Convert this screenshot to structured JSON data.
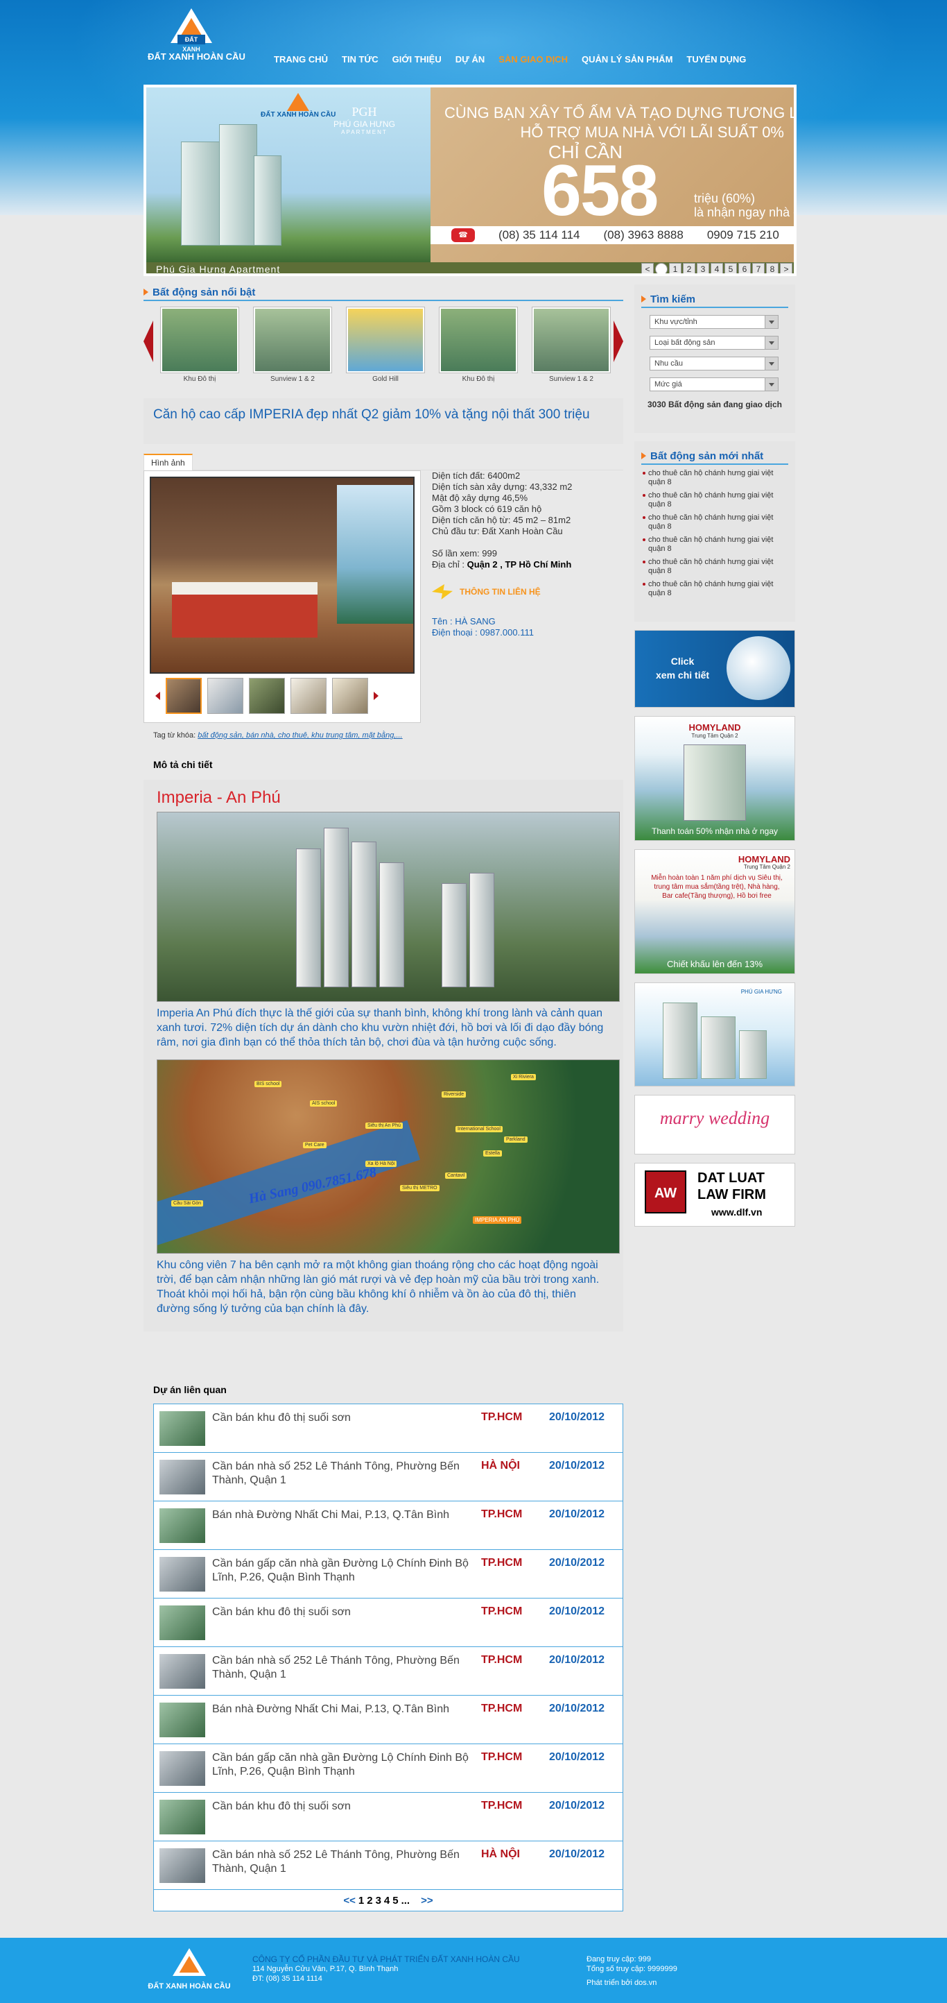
{
  "brand": {
    "logo_mark": "ĐẤT XANH",
    "name": "ĐẤT XANH HOÀN CẦU"
  },
  "nav": [
    {
      "label": "TRANG CHỦ",
      "active": false
    },
    {
      "label": "TIN TỨC",
      "active": false
    },
    {
      "label": "GIỚI THIỆU",
      "active": false
    },
    {
      "label": "DỰ ÁN",
      "active": false
    },
    {
      "label": "SÀN GIAO DỊCH",
      "active": true
    },
    {
      "label": "QUẢN LÝ SẢN PHẨM",
      "active": false
    },
    {
      "label": "TUYỂN DỤNG",
      "active": false
    }
  ],
  "banner": {
    "logo_text": "ĐẤT XANH HOÀN CẦU",
    "pgh": "PHÚ GIA HƯNG",
    "pgh_sub": "APARTMENT",
    "line1": "CÙNG BẠN XÂY TỔ ẤM VÀ TẠO DỰNG TƯƠNG LAI",
    "line2": "HỖ TRỢ MUA NHÀ VỚI LÃI SUẤT 0%",
    "line3": "CHỈ CẦN",
    "number": "658",
    "line4": "triệu (60%)",
    "line5": "là nhận ngay nhà ở",
    "phones": [
      "(08) 35 114 114",
      "(08) 3963 8888",
      "0909 715 210"
    ],
    "caption": "Phú Gia Hưng Apartment",
    "pages": [
      "<",
      "",
      "1",
      "2",
      "3",
      "4",
      "5",
      "6",
      "7",
      "8",
      ">"
    ]
  },
  "featured": {
    "title": "Bất động sản nổi bật",
    "items": [
      {
        "label": "Khu Đô thị",
        "color1": "#8cb07a",
        "color2": "#4a7c59"
      },
      {
        "label": "Sunview 1 & 2",
        "color1": "#a7c29a",
        "color2": "#5a7d63"
      },
      {
        "label": "Gold Hill",
        "color1": "#f5d35b",
        "color2": "#5fa8d6"
      },
      {
        "label": "Khu Đô thị",
        "color1": "#8cb07a",
        "color2": "#4a7c59"
      },
      {
        "label": "Sunview 1 & 2",
        "color1": "#a7c29a",
        "color2": "#5a7d63"
      }
    ]
  },
  "listing": {
    "title": "Căn hộ cao cấp IMPERIA đẹp nhất Q2 giảm 10% và tặng nội thất 300 triệu",
    "tab": "Hình ảnh",
    "specs": [
      "Diện tích đất: 6400m2",
      "Diện tích sàn xây dựng: 43,332 m2",
      "Mật độ xây dựng 46,5%",
      "Gồm 3 block có 619 căn hộ",
      "Diện tích căn hộ từ: 45 m2 – 81m2",
      "Chủ đầu tư: Đất Xanh Hoàn Cầu"
    ],
    "views": "Số lần xem: 999",
    "addr_label": "Địa chỉ :",
    "addr": "Quận 2 , TP Hồ Chí Minh",
    "contact_btn": "THÔNG TIN LIÊN HỆ",
    "contact_name": "Tên : HÀ SANG",
    "contact_phone": "Điện thoại : 0987.000.111",
    "tags_label": "Tag từ khóa:",
    "tags": "bất động sản, bán nhà, cho thuê, khu trung tâm, mặt bằng,..."
  },
  "description": {
    "heading": "Mô tả chi tiết",
    "title": "Imperia - An Phú",
    "para1": "Imperia An Phú đích thực là thế giới của sự thanh bình, không khí trong lành và cảnh quan xanh tươi. 72% diện tích dự án dành cho khu vườn nhiệt đới, hồ bơi và lối đi dạo đầy bóng râm, nơi gia đình bạn có thể thỏa thích tản bộ, chơi đùa và tận hưởng cuộc sống.",
    "map_watermark": "Hà Sang 090.7851.678",
    "map_pins": [
      "BIS school",
      "AIS school",
      "Siêu thị An Phú",
      "Riverside",
      "Xi Riviera",
      "International School",
      "Parkland",
      "Estella",
      "Pet Care",
      "Xa lộ Hà Nội",
      "Cantavil",
      "Cầu Sài Gòn",
      "Siêu thị METRO",
      "IMPERIA AN PHÚ"
    ],
    "para2": "Khu công viên 7 ha bên cạnh mở ra một không gian thoáng rộng cho các hoạt động ngoài trời, để bạn cảm nhận những làn gió mát rượi và vẻ đẹp hoàn mỹ của bầu trời trong xanh. Thoát khỏi mọi hối hả, bận rộn cùng bầu không khí ô nhiễm và ồn ào của đô thị, thiên đường sống lý tưởng của bạn chính là đây."
  },
  "related": {
    "heading": "Dự án liên quan",
    "rows": [
      {
        "text": "Cần bán khu đô thị suối sơn",
        "city": "TP.HCM",
        "date": "20/10/2012"
      },
      {
        "text": "Cần bán nhà số 252 Lê Thánh Tông, Phường Bến Thành, Quận 1",
        "city": "HÀ NỘI",
        "date": "20/10/2012"
      },
      {
        "text": "Bán nhà Đường Nhất Chi Mai, P.13, Q.Tân Bình",
        "city": "TP.HCM",
        "date": "20/10/2012"
      },
      {
        "text": "Cần bán gấp căn nhà gần Đường Lộ Chính Đinh Bộ Lĩnh, P.26, Quận Bình Thạnh",
        "city": "TP.HCM",
        "date": "20/10/2012"
      },
      {
        "text": "Cần bán khu đô thị suối sơn",
        "city": "TP.HCM",
        "date": "20/10/2012"
      },
      {
        "text": "Cần bán nhà số 252 Lê Thánh Tông, Phường Bến Thành, Quận 1",
        "city": "TP.HCM",
        "date": "20/10/2012"
      },
      {
        "text": "Bán nhà Đường Nhất Chi Mai, P.13, Q.Tân Bình",
        "city": "TP.HCM",
        "date": "20/10/2012"
      },
      {
        "text": "Cần bán gấp căn nhà gần Đường Lộ Chính Đinh Bộ Lĩnh, P.26, Quận Bình Thạnh",
        "city": "TP.HCM",
        "date": "20/10/2012"
      },
      {
        "text": "Cần bán khu đô thị suối sơn",
        "city": "TP.HCM",
        "date": "20/10/2012"
      },
      {
        "text": "Cần bán nhà số 252 Lê Thánh Tông, Phường Bến Thành, Quận 1",
        "city": "HÀ NỘI",
        "date": "20/10/2012"
      }
    ],
    "pages": {
      "prev": "<<",
      "nums": [
        "1",
        "2",
        "3",
        "4",
        "5",
        "..."
      ],
      "next": ">>"
    }
  },
  "search": {
    "title": "Tìm kiếm",
    "selects": [
      "Khu vực/tỉnh",
      "Loại bất động sản",
      "Nhu cầu",
      "Mức giá"
    ],
    "count": "3030 Bất động sản đang giao dịch"
  },
  "newest": {
    "title": "Bất động sản mới nhất",
    "items": [
      "cho thuê căn hộ chánh hưng giai việt quận 8",
      "cho thuê căn hộ chánh hưng giai việt quận 8",
      "cho thuê căn hộ chánh hưng giai việt quận 8",
      "cho thuê căn hộ chánh hưng giai việt quận 8",
      "cho thuê căn hộ chánh hưng giai việt quận 8",
      "cho thuê căn hộ chánh hưng giai việt quận 8"
    ]
  },
  "ads": {
    "ad1": "Click\nxem chi tiết",
    "ad2_brand": "HOMYLAND",
    "ad2_sub": "Trung Tâm Quận 2",
    "ad2_text": "Thanh toán 50% nhận nhà ở ngay",
    "ad3_brand": "HOMYLAND",
    "ad3_sub": "Trung Tâm Quận 2",
    "ad3_text": "Miễn hoàn toàn 1 năm phí dịch vụ Siêu thị, trung tâm mua sắm(tầng trệt), Nhà hàng, Bar cafe(Tầng thượng), Hồ bơi free",
    "ad3_foot": "Chiết khấu lên đến 13%",
    "ad4": "PHÚ GIA HƯNG",
    "ad5": "marry wedding",
    "ad6_l1": "DAT LUAT",
    "ad6_l2": "LAW FIRM",
    "ad6_l3": "www.dlf.vn",
    "ad6_mark": "AW"
  },
  "footer": {
    "company": "CÔNG TY CỔ PHẦN ĐẦU TƯ VÀ PHÁT TRIỂN ĐẤT XANH HOÀN CẦU",
    "address": "114 Nguyễn Cửu Vân, P.17, Q. Bình Thạnh",
    "phone": "ĐT: (08) 35 114 1114",
    "online": "Đang truy cập: 999",
    "total": "Tổng số truy cập: 9999999",
    "dev": "Phát triển bởi dos.vn"
  },
  "colors": {
    "accent": "#1863b3",
    "orange": "#f7941d",
    "red": "#b3141c",
    "footer": "#1fa0e5"
  }
}
